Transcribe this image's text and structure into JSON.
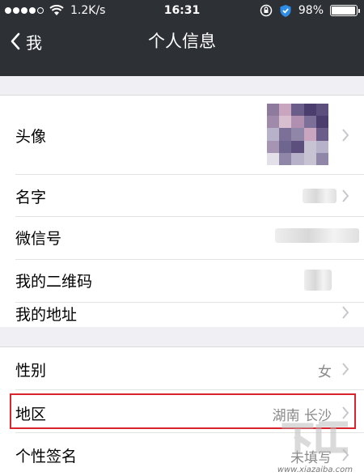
{
  "status_bar": {
    "signal_filled": 4,
    "signal_total": 5,
    "network_speed": "1.2K/s",
    "time": "16:31",
    "battery_percent": "98%",
    "battery_level": 0.98,
    "icons": [
      "wifi-icon",
      "rotation-lock-icon",
      "shield-icon",
      "battery-icon"
    ]
  },
  "nav": {
    "back_label": "我",
    "title": "个人信息"
  },
  "section1": {
    "rows": [
      {
        "label": "头像",
        "value": ""
      },
      {
        "label": "名字",
        "value": ""
      },
      {
        "label": "微信号",
        "value": ""
      },
      {
        "label": "我的二维码",
        "value": ""
      },
      {
        "label": "我的地址",
        "value": ""
      }
    ]
  },
  "section2": {
    "rows": [
      {
        "label": "性别",
        "value": "女"
      },
      {
        "label": "地区",
        "value": "湖南 长沙"
      },
      {
        "label": "个性签名",
        "value": "未填写"
      }
    ]
  },
  "colors": {
    "nav_bg": "#2d3035",
    "page_bg": "#efeff4",
    "highlight": "#d9232d",
    "value_text": "#888888"
  },
  "watermark": {
    "text": "www.xiazaiba.com"
  }
}
